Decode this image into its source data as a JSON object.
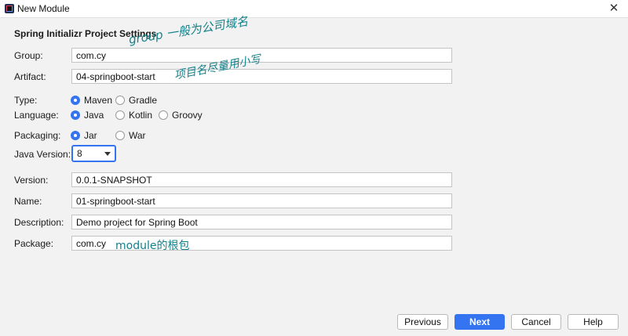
{
  "window": {
    "title": "New Module",
    "close_glyph": "✕"
  },
  "section_title": "Spring Initializr Project Settings",
  "fields": {
    "group": {
      "label": "Group:",
      "value": "com.cy"
    },
    "artifact": {
      "label": "Artifact:",
      "value": "04-springboot-start"
    },
    "version": {
      "label": "Version:",
      "value": "0.0.1-SNAPSHOT"
    },
    "name": {
      "label": "Name:",
      "value": "01-springboot-start"
    },
    "description": {
      "label": "Description:",
      "value": "Demo project for Spring Boot"
    },
    "package": {
      "label": "Package:",
      "value": "com.cy"
    }
  },
  "type": {
    "label": "Type:",
    "options": [
      "Maven",
      "Gradle"
    ],
    "selected": "Maven"
  },
  "language": {
    "label": "Language:",
    "options": [
      "Java",
      "Kotlin",
      "Groovy"
    ],
    "selected": "Java"
  },
  "packaging": {
    "label": "Packaging:",
    "options": [
      "Jar",
      "War"
    ],
    "selected": "Jar"
  },
  "java_version": {
    "label": "Java Version:",
    "value": "8"
  },
  "annotations": {
    "group_note": "group 一般为公司域名",
    "artifact_note": "项目名尽量用小写",
    "package_note": "module的根包"
  },
  "buttons": {
    "previous": "Previous",
    "next": "Next",
    "cancel": "Cancel",
    "help": "Help"
  },
  "colors": {
    "accent": "#3574f0",
    "annotation": "#13808a",
    "background": "#f2f2f2"
  },
  "icons": {
    "app": "intellij-app-icon",
    "close": "close-icon",
    "dropdown": "chevron-down-icon"
  }
}
